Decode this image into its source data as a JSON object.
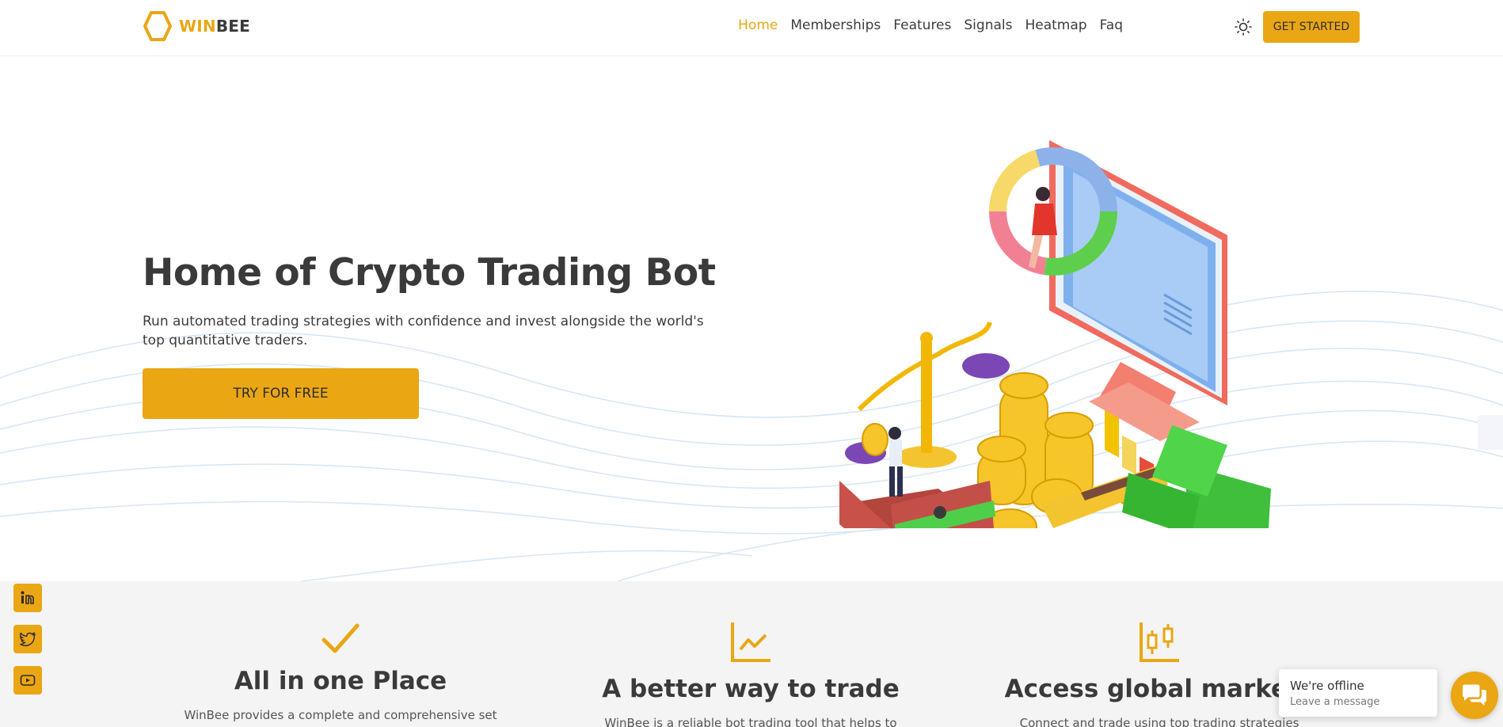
{
  "brand": {
    "win": "WIN",
    "bee": "BEE",
    "accent": "#eaa613",
    "logo_icon": "hexagon-logo-icon"
  },
  "nav": {
    "items": [
      {
        "label": "Home",
        "active": true
      },
      {
        "label": "Memberships",
        "active": false
      },
      {
        "label": "Features",
        "active": false
      },
      {
        "label": "Signals",
        "active": false
      },
      {
        "label": "Heatmap",
        "active": false
      },
      {
        "label": "Faq",
        "active": false
      }
    ],
    "theme_icon": "sun-icon",
    "cta_label": "GET STARTED"
  },
  "hero": {
    "title": "Home of Crypto Trading Bot",
    "subtitle": "Run automated trading strategies with confidence and invest alongside the world's top quantitative traders.",
    "cta_label": "TRY FOR FREE"
  },
  "features": [
    {
      "icon": "checkmark-icon",
      "title": "All in one Place",
      "text": "WinBee provides a complete and comprehensive set"
    },
    {
      "icon": "line-chart-icon",
      "title": "A better way to trade",
      "text": "WinBee is a reliable bot trading tool that helps to"
    },
    {
      "icon": "candlestick-icon",
      "title": "Access global markets",
      "text": "Connect and trade using top trading strategies"
    }
  ],
  "social": [
    {
      "icon": "linkedin-icon"
    },
    {
      "icon": "twitter-icon"
    },
    {
      "icon": "youtube-icon"
    }
  ],
  "chat": {
    "title": "We're offline",
    "subtitle": "Leave a message",
    "icon": "chat-icon"
  }
}
